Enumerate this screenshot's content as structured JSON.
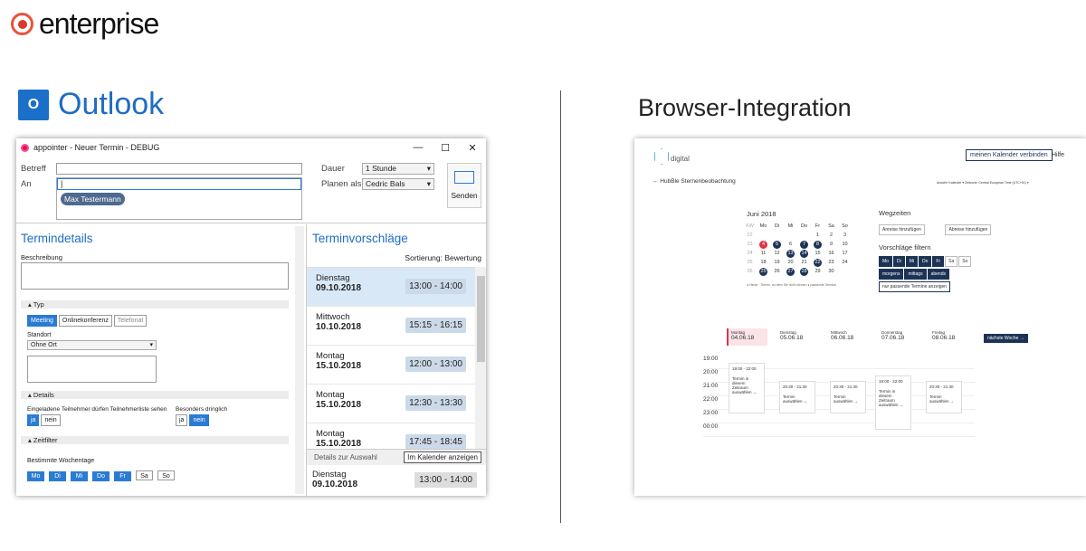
{
  "brand": {
    "name": "enterprise"
  },
  "outlook_heading": {
    "icon": "O",
    "label": "Outlook"
  },
  "browser_heading": "Browser-Integration",
  "outlook": {
    "title": "appointer - Neuer Termin - DEBUG",
    "betreff_label": "Betreff",
    "an_label": "An",
    "recipient": "Max Testermann",
    "dauer_label": "Dauer",
    "dauer_value": "1 Stunde",
    "planen_label": "Planen als",
    "planen_value": "Cedric Bals",
    "send_label": "Senden",
    "details_heading": "Termindetails",
    "beschreibung_label": "Beschreibung",
    "typ_section": "Typ",
    "typ_buttons": [
      "Meeting",
      "Onlinekonferenz",
      "Telefonat"
    ],
    "standort_label": "Standort",
    "standort_value": "Ohne Ort",
    "details_section": "Details",
    "teilnehmer_label": "Eingeladene Teilnehmer dürfen Teilnehmerliste sehen",
    "dringlich_label": "Besonders dringlich",
    "ja": "ja",
    "nein": "nein",
    "zeitfilter_section": "Zeitfilter",
    "wochentage_label": "Bestimmte Wochentage",
    "days": [
      "Mo",
      "Di",
      "Mi",
      "Do",
      "Fr",
      "Sa",
      "So"
    ],
    "suggestions_heading": "Terminvorschläge",
    "sort_label": "Sortierung: Bewertung",
    "suggestions": [
      {
        "day": "Dienstag",
        "date": "09.10.2018",
        "time": "13:00 - 14:00"
      },
      {
        "day": "Mittwoch",
        "date": "10.10.2018",
        "time": "15:15 - 16:15"
      },
      {
        "day": "Montag",
        "date": "15.10.2018",
        "time": "12:00 - 13:00"
      },
      {
        "day": "Montag",
        "date": "15.10.2018",
        "time": "12:30 - 13:30"
      },
      {
        "day": "Montag",
        "date": "15.10.2018",
        "time": "17:45 - 18:45"
      }
    ],
    "details_auswahl": "Details zur Auswahl",
    "kalender_btn": "Im Kalender anzeigen",
    "selected": {
      "day": "Dienstag",
      "date": "09.10.2018",
      "time": "13:00 - 14:00"
    }
  },
  "browser": {
    "logo_text": "digital",
    "connect_btn": "meinen Kalender verbinden",
    "help": "Hilfe",
    "back_label": "← HubBle Sternenbeobachtung",
    "tz_label": "Ansicht: Kalender ▾   Zeitzone: Central European Time (UTC+01) ▾",
    "month": "Juni 2018",
    "weekdays": [
      "KW",
      "Mo",
      "Di",
      "Mi",
      "Do",
      "Fr",
      "Sa",
      "So"
    ],
    "weeks": [
      [
        "22",
        "",
        "",
        "",
        "",
        "1",
        "2",
        "3"
      ],
      [
        "23",
        "4",
        "5",
        "6",
        "7",
        "8",
        "9",
        "10"
      ],
      [
        "24",
        "11",
        "12",
        "13",
        "14",
        "15",
        "16",
        "17"
      ],
      [
        "25",
        "18",
        "19",
        "20",
        "21",
        "22",
        "23",
        "24"
      ],
      [
        "26",
        "25",
        "26",
        "27",
        "28",
        "29",
        "30",
        ""
      ]
    ],
    "legend": "● Heute   · Termin, an dem Sie nicht können   ● passende Termine",
    "wegzeiten": "Wegzeiten",
    "anreise": "Anreise hinzufügen",
    "abreise": "Abreise hinzufügen",
    "filter_label": "Vorschläge filtern",
    "filter_days": [
      "Mo",
      "Di",
      "Mi",
      "Do",
      "Fr",
      "Sa",
      "So"
    ],
    "filter_times": [
      "morgens",
      "mittags",
      "abends"
    ],
    "only_match": "nur passende Termine anzeigen",
    "week_days": [
      {
        "name": "Montag",
        "date": "04.06.18"
      },
      {
        "name": "Dienstag",
        "date": "05.06.18"
      },
      {
        "name": "Mittwoch",
        "date": "06.06.18"
      },
      {
        "name": "Donnerstag",
        "date": "07.06.18"
      },
      {
        "name": "Freitag",
        "date": "08.06.18"
      }
    ],
    "next_week": "nächste Woche →",
    "hours": [
      "19:00",
      "20:00",
      "21:00",
      "22:00",
      "23:00",
      "00:00"
    ],
    "slots": [
      {
        "time": "19:00 - 22:00",
        "text": "Termin in diesem Zeitraum auswählen →"
      },
      {
        "time": "20:30 - 21:30",
        "text": "Termin auswählen →"
      },
      {
        "time": "20:30 - 21:30",
        "text": "Termin auswählen →"
      },
      {
        "time": "19:00 - 22:00",
        "text": "Termin in diesem Zeitraum auswählen →"
      },
      {
        "time": "20:30 - 21:30",
        "text": "Termin auswählen →"
      }
    ]
  },
  "colors": {
    "accent": "#1f6dc3",
    "dark_navy": "#1d3356",
    "brand_red": "#e8543d"
  }
}
